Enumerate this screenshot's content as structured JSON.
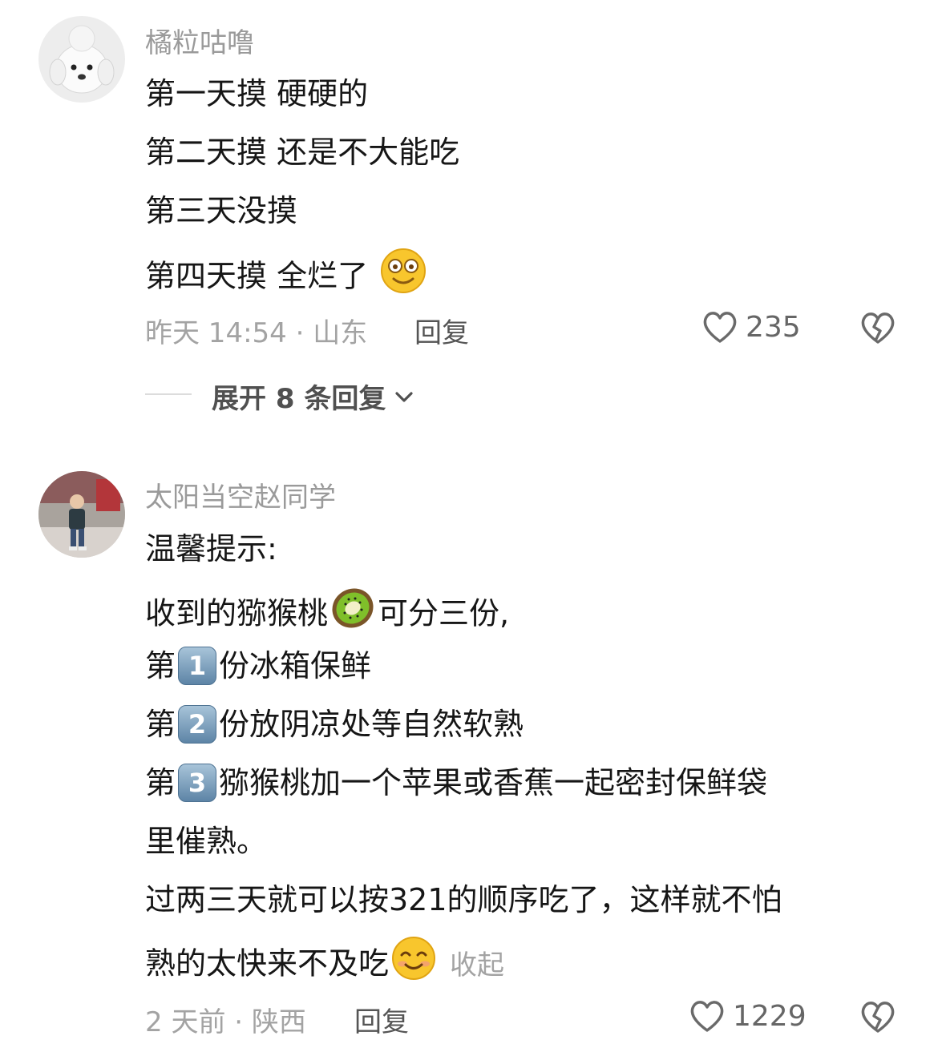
{
  "comments": [
    {
      "username": "橘粒咕噜",
      "lines": [
        "第一天摸 硬硬的",
        "第二天摸 还是不大能吃",
        "第三天没摸",
        "第四天摸 全烂了"
      ],
      "time_location": "昨天 14:54 · 山东",
      "reply_label": "回复",
      "likes": "235",
      "expand_label": "展开 8 条回复",
      "line4_emoji": "astonished-smile-emoji"
    },
    {
      "username": "太阳当空赵同学",
      "line1": "温馨提示:",
      "line2_a": "收到的猕猴桃",
      "line2_b": "可分三份,",
      "line3_prefix": "第",
      "line3_num": "1",
      "line3_text": "份冰箱保鲜",
      "line4_prefix": "第",
      "line4_num": "2",
      "line4_text": "份放阴凉处等自然软熟",
      "line5_prefix": "第",
      "line5_num": "3",
      "line5_text": "猕猴桃加一个苹果或香蕉一起密封保鲜袋",
      "line6": "里催熟。",
      "line7": "过两三天就可以按321的顺序吃了，这样就不怕",
      "line8": "熟的太快来不及吃",
      "collapse_label": "收起",
      "time_location": "2 天前 · 陕西",
      "reply_label": "回复",
      "likes": "1229"
    }
  ],
  "colors": {
    "text": "#161616",
    "meta": "#a3a3a3",
    "username": "#9a9a9a"
  }
}
